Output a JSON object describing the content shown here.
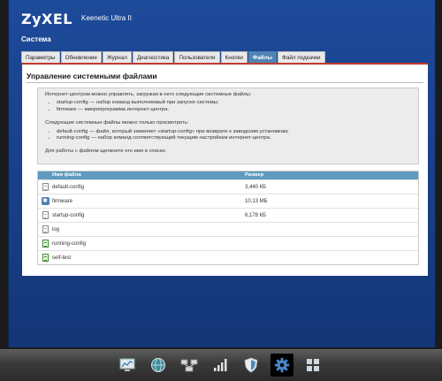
{
  "header": {
    "brand": "ZyXEL",
    "model": "Keenetic Ultra II",
    "section": "Система"
  },
  "tabs": [
    {
      "label": "Параметры",
      "active": false
    },
    {
      "label": "Обновление",
      "active": false
    },
    {
      "label": "Журнал",
      "active": false
    },
    {
      "label": "Диагностика",
      "active": false
    },
    {
      "label": "Пользователи",
      "active": false
    },
    {
      "label": "Кнопки",
      "active": false
    },
    {
      "label": "Файлы",
      "active": true
    },
    {
      "label": "Файл подкачки",
      "active": false
    }
  ],
  "content": {
    "title": "Управление системными файлами",
    "info": {
      "intro": "Интернет-центром можно управлять, загружая в него следующие системные файлы:",
      "load_items": [
        "startup-config — набор команд выполняемый при запуске системы;",
        "firmware — микропрограмма интернет-центра."
      ],
      "view_intro": "Следующие системные файлы можно только просмотреть:",
      "view_items": [
        "default-config — файл, который заменяет «startup-config» при возврате к заводским установкам;",
        "running-config — набор команд соответствующий текущим настройкам интернет-центра."
      ],
      "hint": "Для работы с файлом щелкните его имя в списке."
    },
    "table": {
      "col_name": "Имя файла",
      "col_size": "Размер",
      "rows": [
        {
          "name": "default-config",
          "size": "3,440 КБ",
          "icon": "document-icon"
        },
        {
          "name": "firmware",
          "size": "10,13 МБ",
          "icon": "firmware-gear-icon"
        },
        {
          "name": "startup-config",
          "size": "6,178 КБ",
          "icon": "document-icon"
        },
        {
          "name": "log",
          "size": "",
          "icon": "document-icon"
        },
        {
          "name": "running-config",
          "size": "",
          "icon": "green-document-icon"
        },
        {
          "name": "self-test",
          "size": "",
          "icon": "green-document-icon"
        }
      ]
    }
  },
  "dock": [
    {
      "icon": "monitor-chart-icon",
      "active": false
    },
    {
      "icon": "globe-icon",
      "active": false
    },
    {
      "icon": "network-icon",
      "active": false
    },
    {
      "icon": "signal-bars-icon",
      "active": false
    },
    {
      "icon": "shield-icon",
      "active": false
    },
    {
      "icon": "gear-icon",
      "active": true
    },
    {
      "icon": "grid-icon",
      "active": false
    }
  ],
  "colors": {
    "app_blue": "#1d4a9a",
    "tab_active": "#4f83b4",
    "table_header": "#5f9bbf",
    "accent_red": "#c43a2e"
  }
}
